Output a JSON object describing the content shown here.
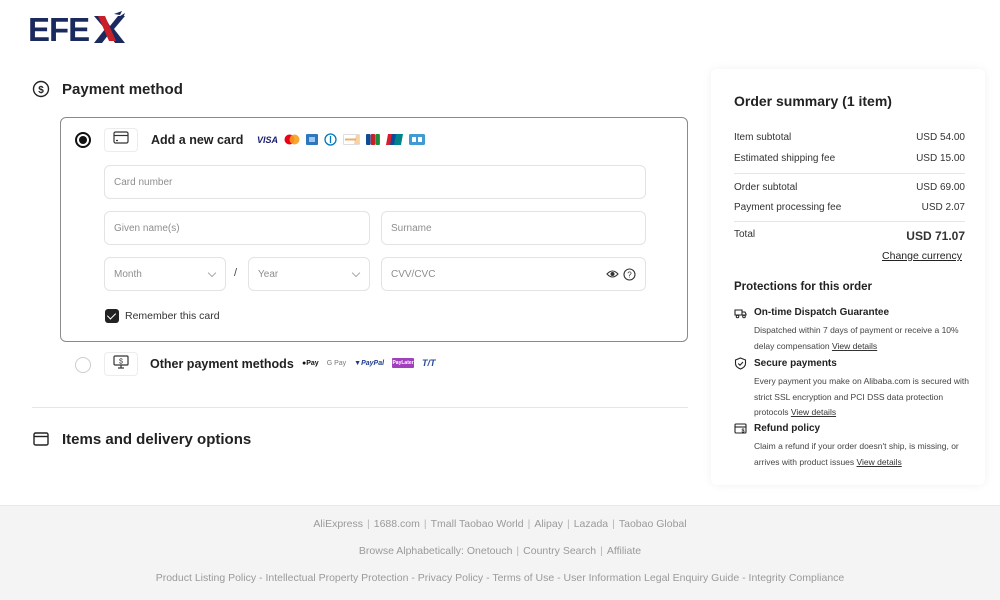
{
  "brand": {
    "name": "EFEX",
    "primary_color": "#1b2a5e",
    "accent_color": "#c8202a"
  },
  "payment": {
    "title": "Payment method",
    "new_card": {
      "label": "Add a new card",
      "selected": true,
      "brands": [
        "VISA",
        "Mastercard",
        "American Express",
        "Diners Club",
        "Discover",
        "JCB",
        "UnionPay",
        "Card"
      ],
      "fields": {
        "card_number": {
          "placeholder": "Card number",
          "value": ""
        },
        "given_name": {
          "placeholder": "Given name(s)",
          "value": ""
        },
        "surname": {
          "placeholder": "Surname",
          "value": ""
        },
        "month": {
          "placeholder": "Month"
        },
        "year": {
          "placeholder": "Year"
        },
        "separator": "/",
        "cvv": {
          "placeholder": "CVV/CVC",
          "value": ""
        }
      },
      "remember": {
        "label": "Remember this card",
        "checked": true
      }
    },
    "other": {
      "label": "Other payment methods",
      "selected": false,
      "brands": [
        "Apple Pay",
        "G Pay",
        "PayPal",
        "Pay Later",
        "T/T"
      ]
    }
  },
  "items": {
    "title": "Items and delivery options"
  },
  "summary": {
    "title": "Order summary (1 item)",
    "rows": [
      {
        "label": "Item subtotal",
        "value": "USD 54.00"
      },
      {
        "label": "Estimated shipping fee",
        "value": "USD 15.00"
      },
      {
        "label": "Order subtotal",
        "value": "USD 69.00"
      },
      {
        "label": "Payment processing fee",
        "value": "USD 2.07"
      }
    ],
    "total": {
      "label": "Total",
      "value": "USD 71.07"
    },
    "change_currency": "Change currency",
    "protections_title": "Protections for this order",
    "protections": [
      {
        "icon": "truck-icon",
        "title": "On-time Dispatch Guarantee",
        "desc": "Dispatched within 7 days of payment or receive a 10% delay compensation",
        "link": "View details"
      },
      {
        "icon": "shield-icon",
        "title": "Secure payments",
        "desc": "Every payment you make on Alibaba.com is secured with strict SSL encryption and PCI DSS data protection protocols",
        "link": "View details"
      },
      {
        "icon": "refund-icon",
        "title": "Refund policy",
        "desc": "Claim a refund if your order doesn't ship, is missing, or arrives with product issues",
        "link": "View details"
      }
    ]
  },
  "footer": {
    "line1": [
      "AliExpress",
      "1688.com",
      "Tmall Taobao World",
      "Alipay",
      "Lazada",
      "Taobao Global"
    ],
    "line2_prefix": "Browse Alphabetically:",
    "line2": [
      "Onetouch",
      "Country Search",
      "Affiliate"
    ],
    "line3": [
      "Product Listing Policy",
      "Intellectual Property Protection",
      "Privacy Policy",
      "Terms of Use",
      "User Information Legal Enquiry Guide",
      "Integrity Compliance"
    ]
  }
}
